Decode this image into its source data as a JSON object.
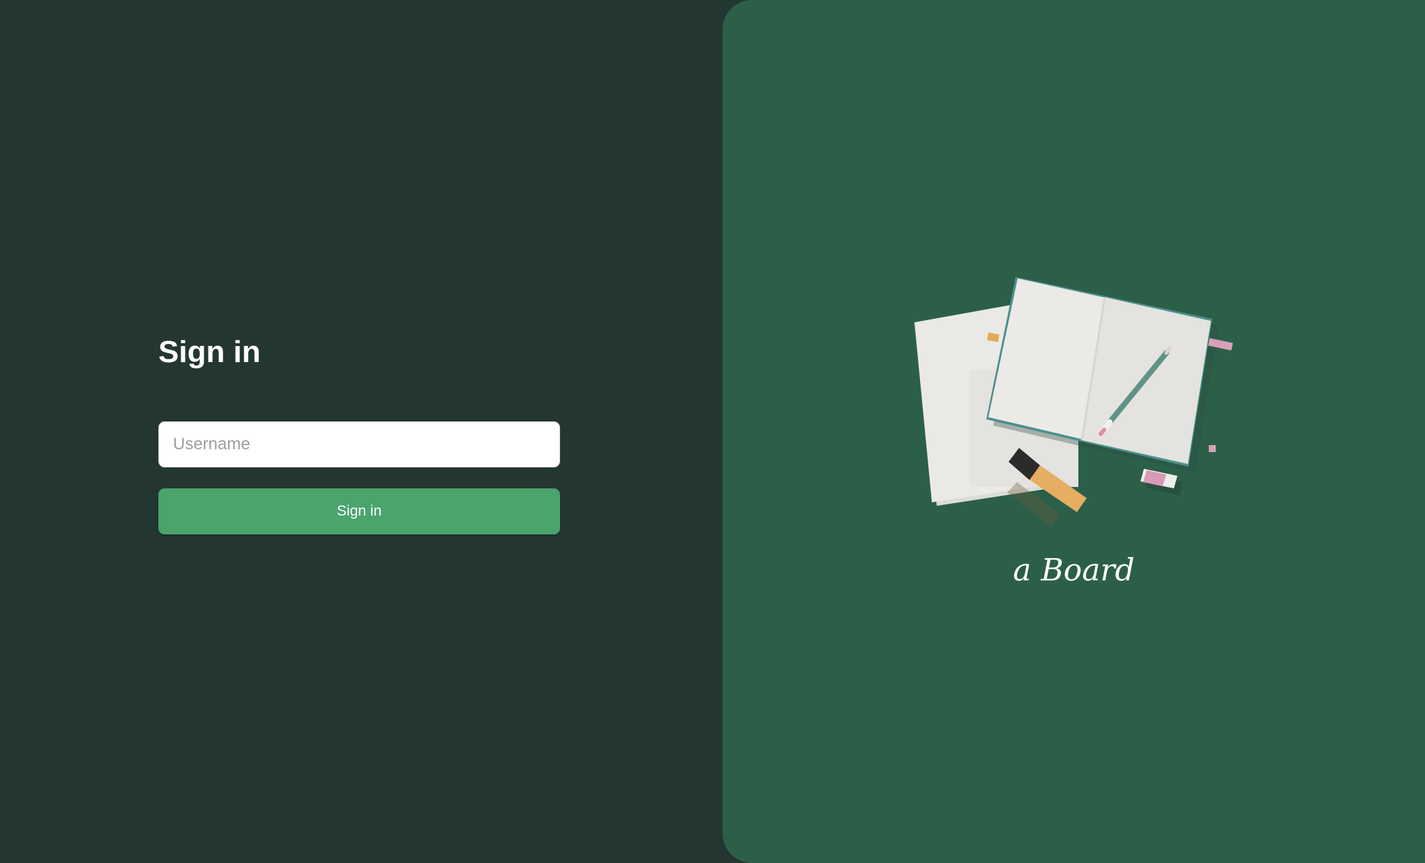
{
  "login": {
    "title": "Sign in",
    "username_placeholder": "Username",
    "username_value": "",
    "submit_label": "Sign in"
  },
  "brand": {
    "name": "a Board"
  },
  "colors": {
    "left_background": "#243631",
    "right_background": "#2c5f48",
    "button": "#4aa46c"
  }
}
